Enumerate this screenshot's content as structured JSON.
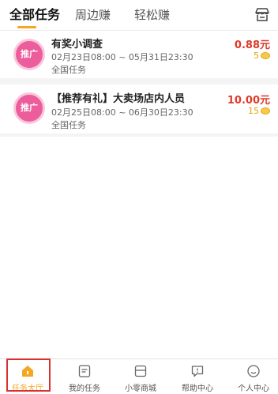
{
  "tabs": [
    {
      "label": "全部任务",
      "active": true
    },
    {
      "label": "周边赚",
      "active": false
    },
    {
      "label": "轻松赚",
      "active": false
    }
  ],
  "top_icon": "shop-icon",
  "tasks": [
    {
      "badge": "推广",
      "title": "有奖小调查",
      "time": "02月23日08:00 ~ 05月31日23:30",
      "scope": "全国任务",
      "price": "0.88元",
      "coins": "5"
    },
    {
      "badge": "推广",
      "title": "【推荐有礼】大卖场店内人员",
      "time": "02月25日08:00 ~ 06月30日23:30",
      "scope": "全国任务",
      "price": "10.00元",
      "coins": "15"
    }
  ],
  "bottom_nav": [
    {
      "label": "任务大厅",
      "icon": "task-hall-icon",
      "active": true
    },
    {
      "label": "我的任务",
      "icon": "my-tasks-icon",
      "active": false
    },
    {
      "label": "小零商城",
      "icon": "store-icon",
      "active": false
    },
    {
      "label": "帮助中心",
      "icon": "help-chat-icon",
      "active": false
    },
    {
      "label": "个人中心",
      "icon": "profile-icon",
      "active": false
    }
  ],
  "colors": {
    "accent": "#f5a623",
    "price": "#e0392b",
    "badge": "#ec5d9c",
    "highlight_frame": "#d93030"
  }
}
